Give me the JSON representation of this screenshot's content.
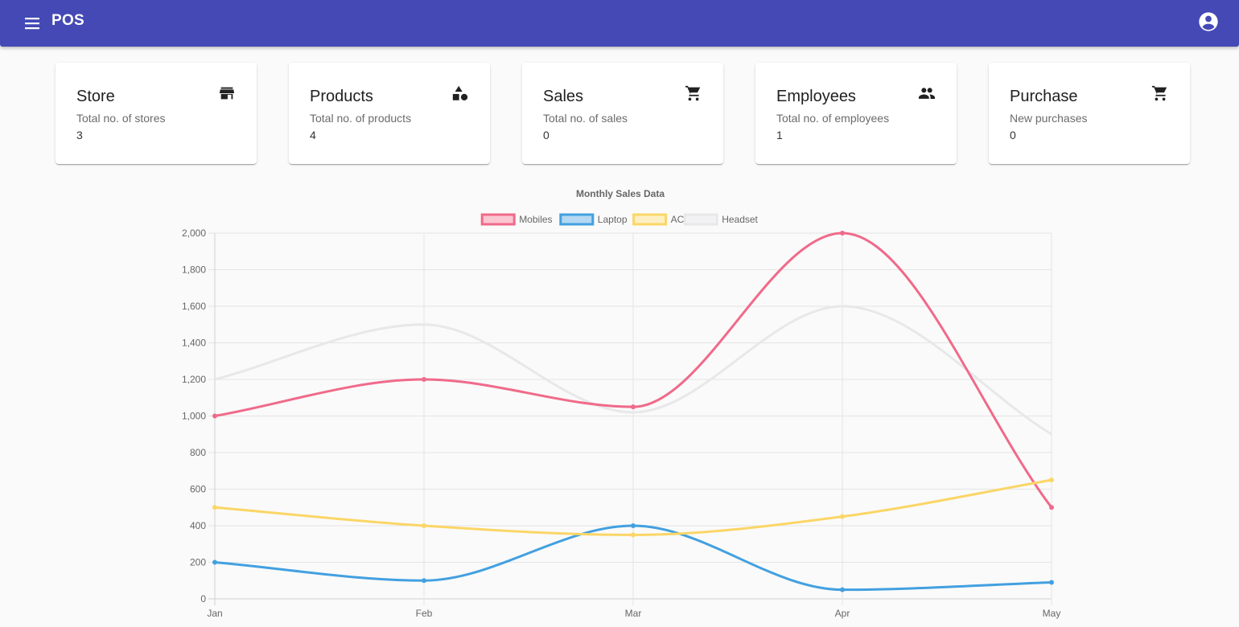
{
  "appbar": {
    "title": "POS",
    "menu_icon": "menu-icon",
    "account_icon": "account-circle-icon"
  },
  "cards": [
    {
      "title": "Store",
      "subtitle": "Total no. of stores",
      "value": "3",
      "icon": "store-icon"
    },
    {
      "title": "Products",
      "subtitle": "Total no. of products",
      "value": "4",
      "icon": "category-shapes-icon"
    },
    {
      "title": "Sales",
      "subtitle": "Total no. of sales",
      "value": "0",
      "icon": "shopping-cart-icon"
    },
    {
      "title": "Employees",
      "subtitle": "Total no. of employees",
      "value": "1",
      "icon": "people-icon"
    },
    {
      "title": "Purchase",
      "subtitle": "New purchases",
      "value": "0",
      "icon": "shopping-cart-icon"
    }
  ],
  "chart_data": {
    "type": "line",
    "title": "Monthly Sales Data",
    "categories": [
      "Jan",
      "Feb",
      "Mar",
      "Apr",
      "May"
    ],
    "ylim": [
      0,
      2000
    ],
    "yticks": [
      "0",
      "200",
      "400",
      "600",
      "800",
      "1,000",
      "1,200",
      "1,400",
      "1,600",
      "1,800",
      "2,000"
    ],
    "grid": true,
    "legend_position": "top-center",
    "series": [
      {
        "name": "Mobiles",
        "values": [
          1000,
          1200,
          1050,
          2000,
          500
        ],
        "color": "#f06a8a",
        "fill": "#fbc6d2",
        "show_points": true
      },
      {
        "name": "Laptop",
        "values": [
          200,
          100,
          400,
          50,
          90
        ],
        "color": "#42a0e0",
        "fill": "#b4d8f3",
        "show_points": true
      },
      {
        "name": "AC",
        "values": [
          500,
          400,
          350,
          450,
          650
        ],
        "color": "#fbd666",
        "fill": "#fdefc2",
        "show_points": true
      },
      {
        "name": "Headset",
        "values": [
          1200,
          1500,
          1020,
          1600,
          900
        ],
        "color": "#e8e8ea",
        "fill": "#f2f2f4",
        "show_points": false
      }
    ]
  }
}
